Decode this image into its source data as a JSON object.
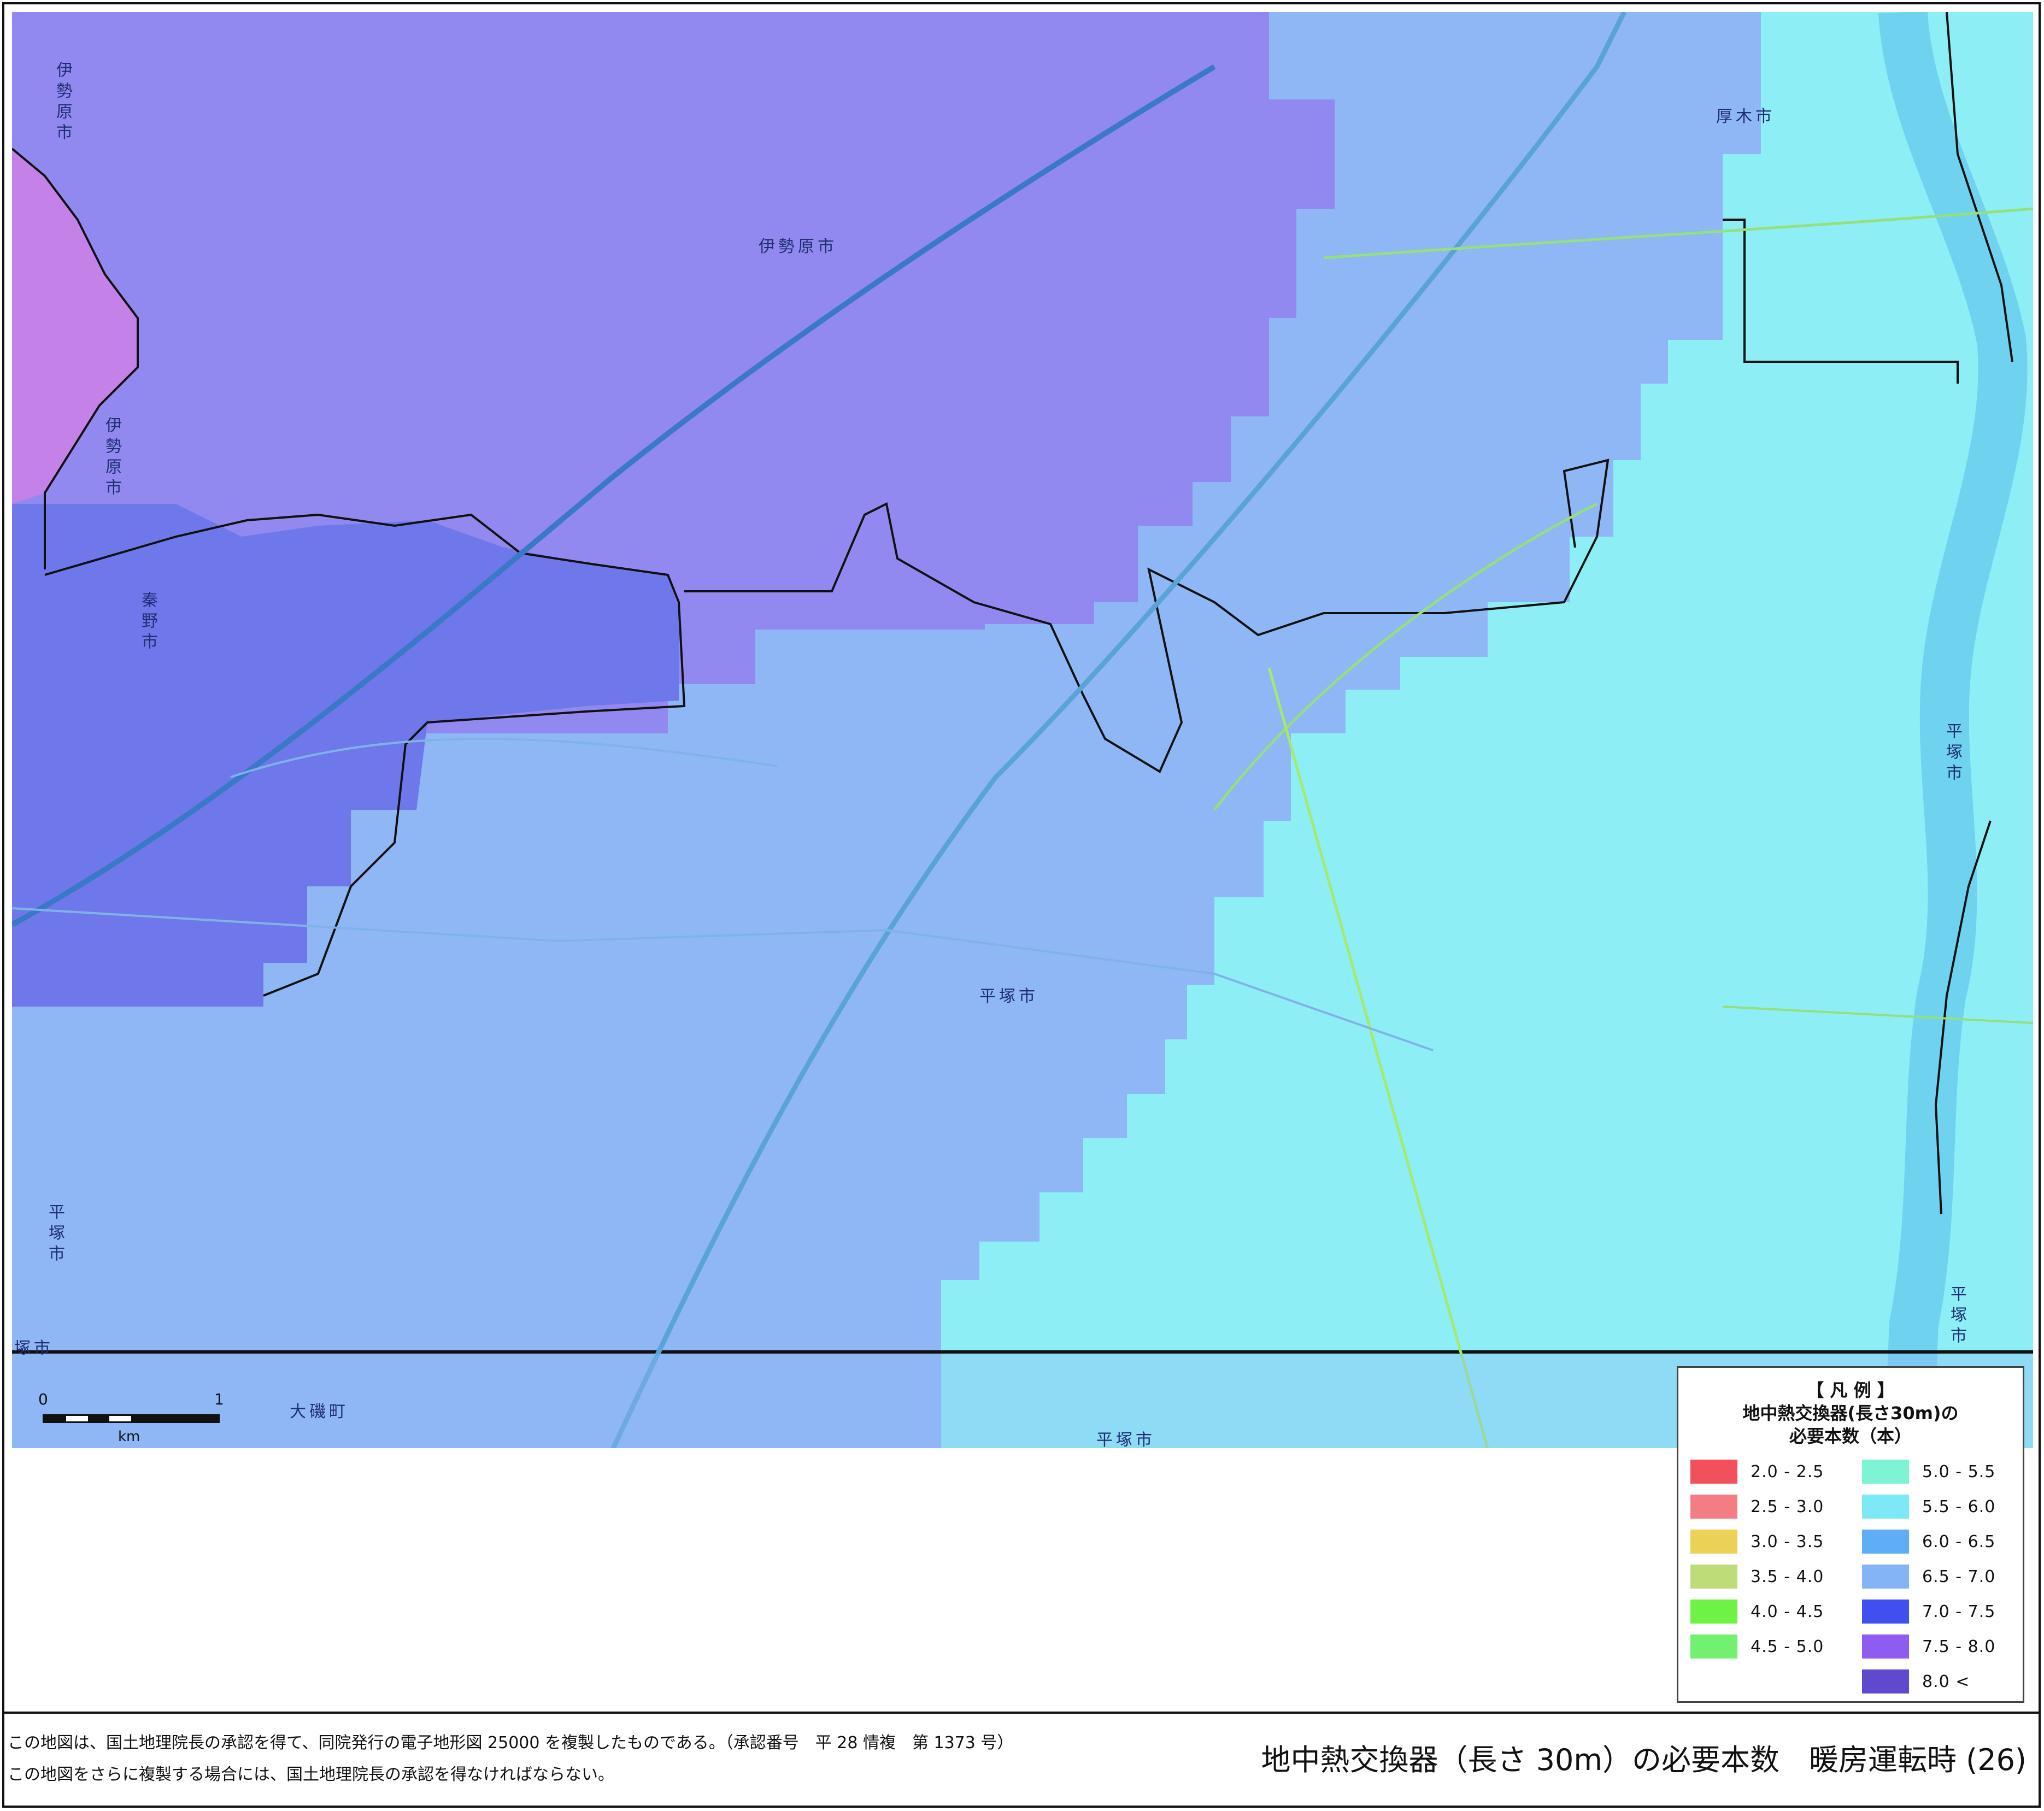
{
  "map": {
    "labels": {
      "isehara_nw": "伊勢原市",
      "isehara_center": "伊勢原市",
      "isehara_w": "伊勢原市",
      "hadano": "秦野市",
      "atsugi": "厚木市",
      "hiratsuka_center": "平塚市",
      "hiratsuka_east": "平塚市",
      "hiratsuka_east2": "平塚市",
      "hiratsuka_west": "平塚市",
      "hiratsuka_bottom": "平塚市",
      "hiratsuka_corner": "塚市",
      "oiso": "大磯町"
    },
    "scale": {
      "zero": "0",
      "one": "1",
      "unit": "km"
    },
    "zone_colors": {
      "magenta": "#c481e8",
      "violet": "#9189ef",
      "indigo": "#6f78ea",
      "blue": "#8fb6f5",
      "cyan": "#8eeef6",
      "river": "#6fd3f0"
    }
  },
  "legend": {
    "title": "【 凡 例 】",
    "subtitle": "地中熱交換器(長さ30m)の",
    "subtitle2": "必要本数（本）",
    "items": [
      {
        "range": "2.0 - 2.5",
        "color": "#f2505a"
      },
      {
        "range": "2.5 - 3.0",
        "color": "#f47d85"
      },
      {
        "range": "3.0 - 3.5",
        "color": "#ecd157"
      },
      {
        "range": "3.5 - 4.0",
        "color": "#bedc78"
      },
      {
        "range": "4.0 - 4.5",
        "color": "#6ff246"
      },
      {
        "range": "4.5 - 5.0",
        "color": "#72f171"
      },
      {
        "range": "5.0 - 5.5",
        "color": "#7ff4d5"
      },
      {
        "range": "5.5 - 6.0",
        "color": "#7de8f6"
      },
      {
        "range": "6.0 - 6.5",
        "color": "#5eaef5"
      },
      {
        "range": "6.5 - 7.0",
        "color": "#85b4f6"
      },
      {
        "range": "7.0 - 7.5",
        "color": "#3f4ff0"
      },
      {
        "range": "7.5 - 8.0",
        "color": "#8f5cf2"
      },
      {
        "range": "8.0 <",
        "color": "#6149cf"
      }
    ]
  },
  "footer": {
    "notice_1": "この地図は、国土地理院長の承認を得て、同院発行の電子地形図 25000 を複製したものである。（承認番号　平 28 情複　第 1373 号）",
    "notice_2": "この地図をさらに複製する場合には、国土地理院長の承認を得なければならない。",
    "title": "地中熱交換器（長さ 30m）の必要本数　暖房運転時 (26)"
  }
}
